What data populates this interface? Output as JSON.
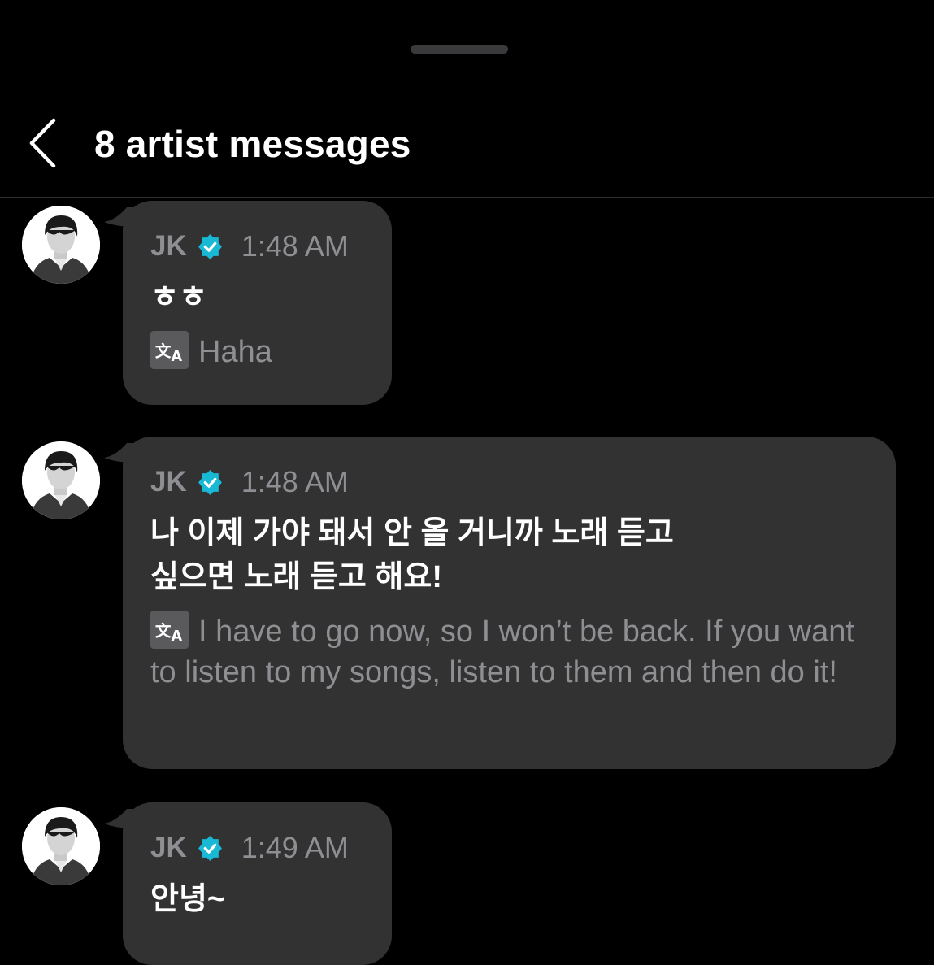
{
  "header": {
    "title": "8 artist messages"
  },
  "colors": {
    "background": "#000000",
    "bubble": "#323232",
    "muted_text": "#8e8e93",
    "verified_badge": "#19b8d4"
  },
  "messages": [
    {
      "sender": "JK",
      "time": "1:48 AM",
      "text": "ㅎㅎ",
      "translation": "Haha"
    },
    {
      "sender": "JK",
      "time": "1:48 AM",
      "text_lines": [
        "나 이제 가야 돼서 안 올 거니까 노래 듣고",
        "싶으면 노래 듣고 해요!"
      ],
      "translation": "I have to go now, so I won’t be back. If you want to listen to my songs, listen to them and then do it!"
    },
    {
      "sender": "JK",
      "time": "1:49 AM",
      "text": "안녕~"
    }
  ]
}
